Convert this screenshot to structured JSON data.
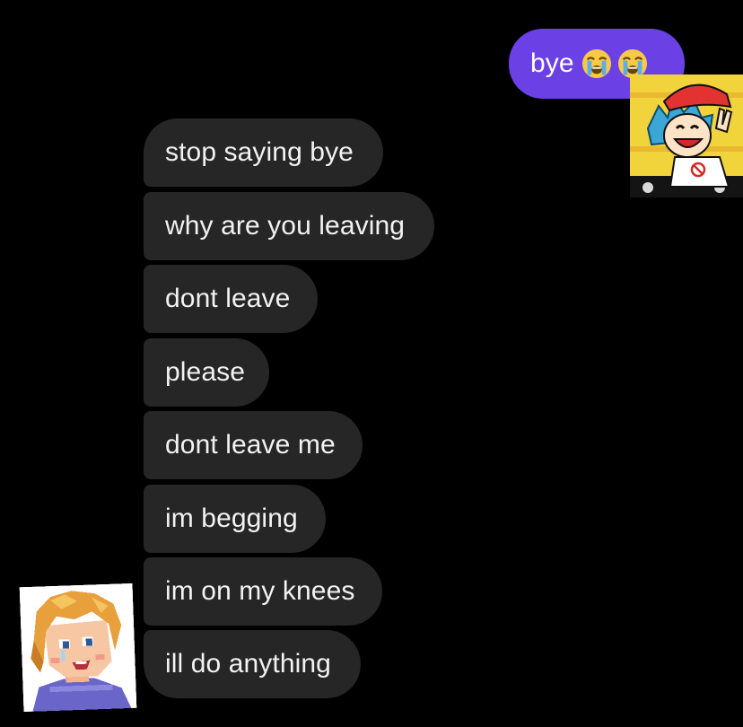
{
  "conversation": {
    "sent": [
      {
        "text": "bye",
        "emojis": [
          "loudly-crying-face-icon",
          "loudly-crying-face-icon"
        ]
      }
    ],
    "received": [
      {
        "text": "stop saying bye"
      },
      {
        "text": "why are you leaving"
      },
      {
        "text": "dont leave"
      },
      {
        "text": "please"
      },
      {
        "text": "dont leave me"
      },
      {
        "text": "im begging"
      },
      {
        "text": "im on my knees"
      },
      {
        "text": "ill do anything"
      }
    ]
  },
  "colors": {
    "background": "#000000",
    "sent_bubble": "#6b41e6",
    "received_bubble": "#262626",
    "text": "#ffffff"
  },
  "avatars": {
    "sender": "cartoon-boy-red-cap-avatar-icon",
    "receiver": "pixel-art-blond-man-avatar-icon"
  }
}
